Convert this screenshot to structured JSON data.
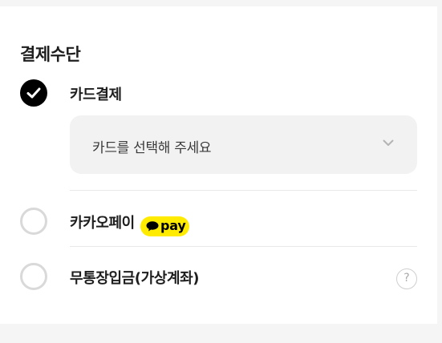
{
  "payment": {
    "section_title": "결제수단",
    "options": [
      {
        "label": "카드결제",
        "selected": true,
        "select": {
          "placeholder": "카드를 선택해 주세요"
        }
      },
      {
        "label": "카카오페이",
        "selected": false,
        "badge": {
          "text": "pay",
          "color": "#FFEB00"
        }
      },
      {
        "label": "무통장입금(가상계좌)",
        "selected": false,
        "help_icon": "question-mark-icon",
        "help_glyph": "?"
      }
    ]
  },
  "icons": {
    "checked_radio": "check-icon",
    "dropdown": "chevron-down-icon",
    "kakao_bubble": "speech-bubble-icon"
  }
}
